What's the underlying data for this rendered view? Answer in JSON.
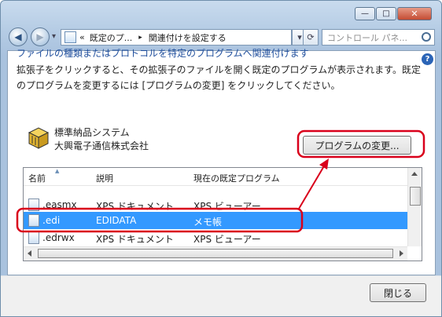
{
  "window": {
    "minimize": "—",
    "maximize": "□",
    "close": "✕"
  },
  "nav": {
    "back": "◀",
    "forward": "▶",
    "dropdown": "▾",
    "breadcrumb": [
      "«",
      "既定のプ...",
      "▸",
      "関連付けを設定する"
    ],
    "refresh": "⟳",
    "search_placeholder": "コントロール パネ..."
  },
  "help": "?",
  "heading": "ファイルの種類またはプロトコルを特定のプログラムへ関連付けます",
  "description": "拡張子をクリックすると、その拡張子のファイルを開く既定のプログラムが表示されます。既定のプログラムを変更するには [プログラムの変更] をクリックしてください。",
  "program": {
    "name": "標準納品システム",
    "publisher": "大興電子通信株式会社"
  },
  "change_button": "プログラムの変更...",
  "list": {
    "columns": [
      "名前",
      "説明",
      "現在の既定プログラム"
    ],
    "rows": [
      {
        "name": ".easmx",
        "description": "XPS ドキュメント",
        "program": "XPS ビューアー"
      },
      {
        "name": ".edi",
        "description": "EDIDATA",
        "program": "メモ帳"
      },
      {
        "name": ".edrwx",
        "description": "XPS ドキュメント",
        "program": "XPS ビューアー"
      }
    ]
  },
  "close_button": "閉じる",
  "colors": {
    "highlight": "#d9001b",
    "selection": "#3399ff",
    "heading": "#1f4e9c"
  }
}
